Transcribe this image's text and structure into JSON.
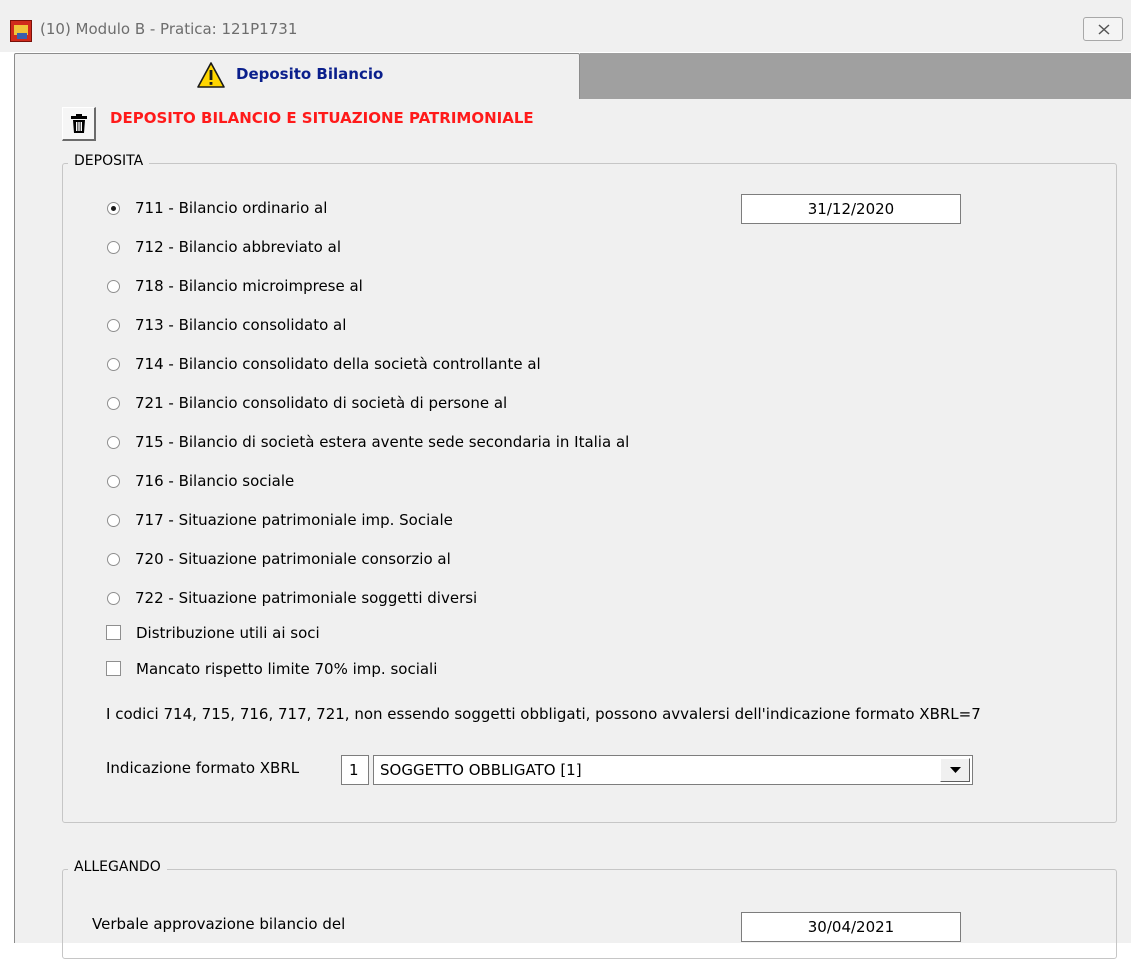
{
  "window": {
    "title": "(10) Modulo B - Pratica: 121P1731",
    "app_icon": "application-logo-icon",
    "close_icon": "close-icon"
  },
  "tab": {
    "label": "Deposito Bilancio",
    "icon": "warning-icon"
  },
  "header": {
    "delete_icon": "trash-icon",
    "title": "DEPOSITO BILANCIO E SITUAZIONE PATRIMONIALE",
    "title_color": "#ff1a1a"
  },
  "deposita": {
    "legend": "DEPOSITA",
    "options": [
      {
        "label": "711 - Bilancio ordinario al",
        "selected": true
      },
      {
        "label": "712 - Bilancio abbreviato al",
        "selected": false
      },
      {
        "label": "718 - Bilancio microimprese al",
        "selected": false
      },
      {
        "label": "713 - Bilancio consolidato al",
        "selected": false
      },
      {
        "label": "714 - Bilancio consolidato della società controllante al",
        "selected": false
      },
      {
        "label": "721 - Bilancio consolidato di società di persone al",
        "selected": false
      },
      {
        "label": "715 - Bilancio di società estera avente sede secondaria in Italia al",
        "selected": false
      },
      {
        "label": "716 - Bilancio sociale",
        "selected": false
      },
      {
        "label": "717 - Situazione patrimoniale imp. Sociale",
        "selected": false
      },
      {
        "label": "720 - Situazione patrimoniale consorzio al",
        "selected": false
      },
      {
        "label": "722 - Situazione patrimoniale soggetti diversi",
        "selected": false
      }
    ],
    "date_value": "31/12/2020",
    "checkboxes": [
      {
        "label": "Distribuzione utili ai soci",
        "checked": false
      },
      {
        "label": "Mancato rispetto limite 70% imp. sociali",
        "checked": false
      }
    ],
    "note": "I codici 714, 715, 716, 717, 721, non essendo soggetti obbligati, possono avvalersi dell'indicazione formato XBRL=7",
    "xbrl": {
      "label": "Indicazione formato XBRL",
      "code": "1",
      "selected": "SOGGETTO OBBLIGATO [1]",
      "dropdown_icon": "chevron-down-icon"
    }
  },
  "allegando": {
    "legend": "ALLEGANDO",
    "verbale_label": "Verbale approvazione bilancio del",
    "verbale_date": "30/04/2021"
  }
}
